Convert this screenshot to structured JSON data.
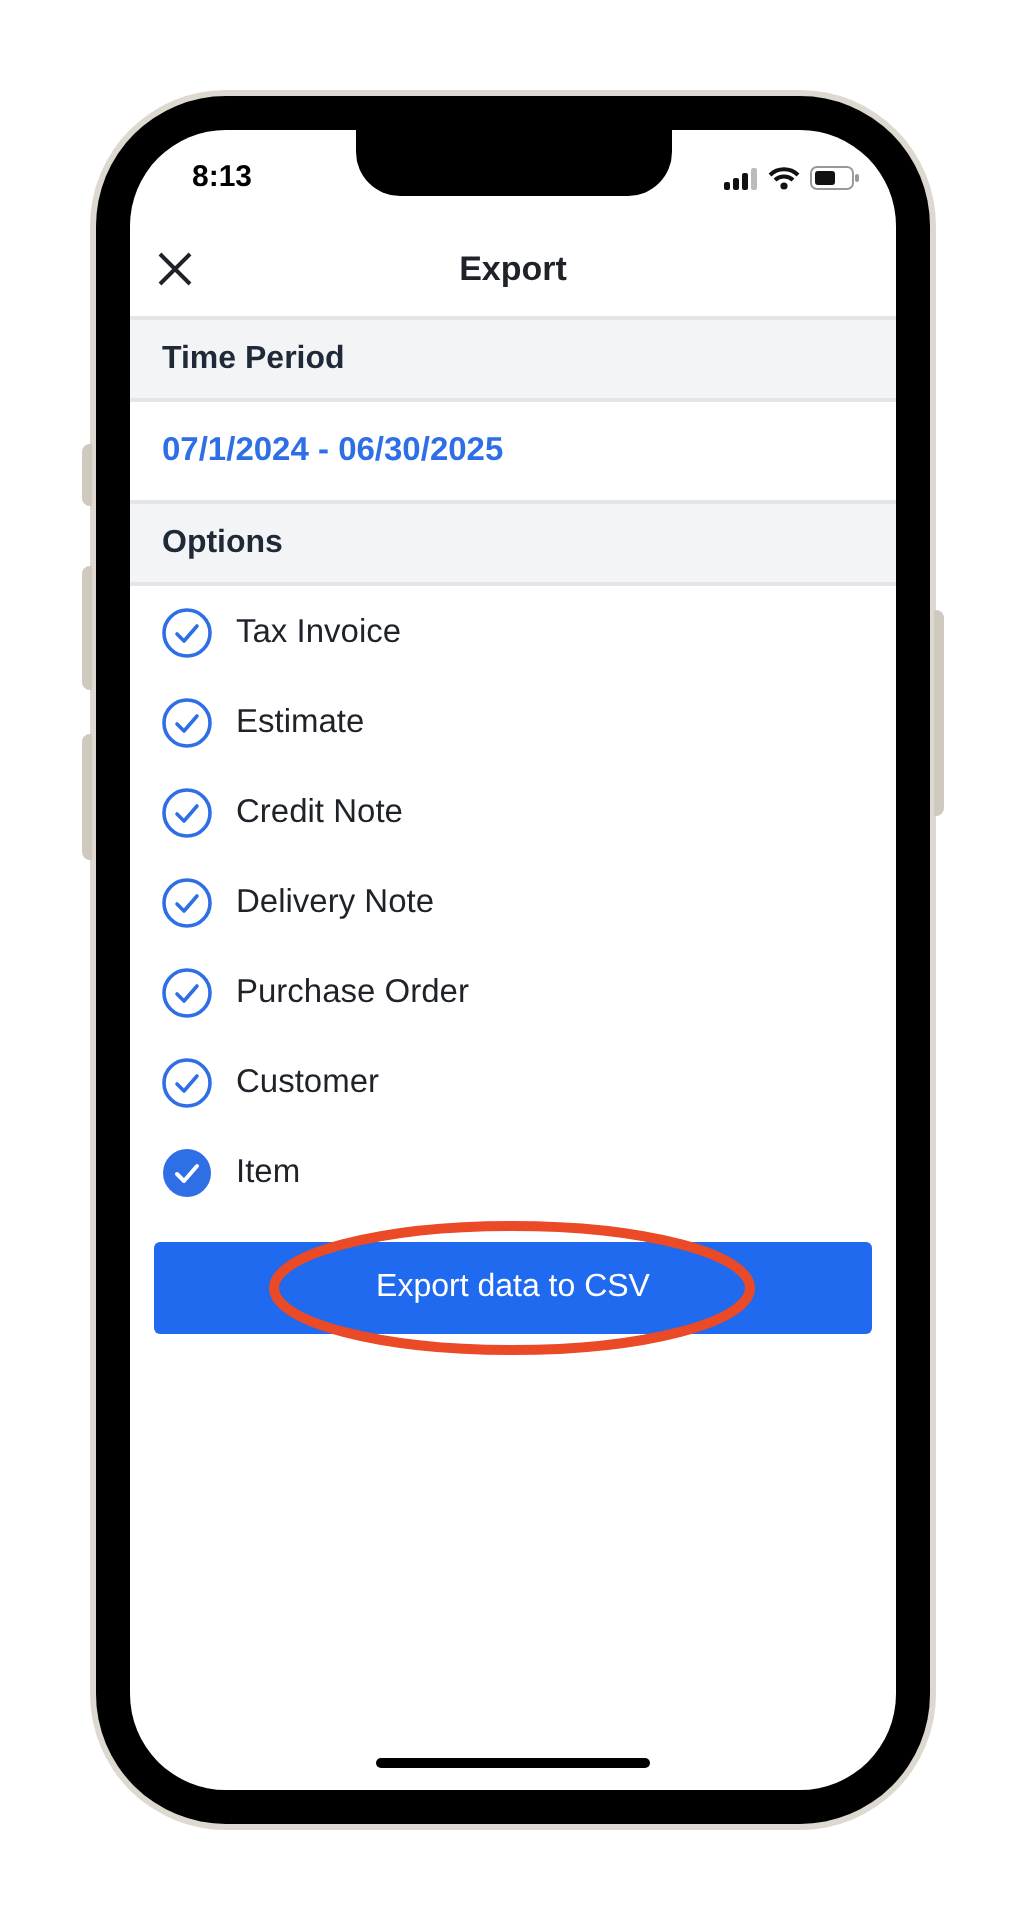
{
  "status_bar": {
    "time": "8:13"
  },
  "header": {
    "title": "Export"
  },
  "time_period": {
    "heading": "Time Period",
    "range": "07/1/2024 - 06/30/2025"
  },
  "options": {
    "heading": "Options",
    "items": [
      {
        "label": "Tax Invoice",
        "selected": false
      },
      {
        "label": "Estimate",
        "selected": false
      },
      {
        "label": "Credit Note",
        "selected": false
      },
      {
        "label": "Delivery Note",
        "selected": false
      },
      {
        "label": "Purchase Order",
        "selected": false
      },
      {
        "label": "Customer",
        "selected": false
      },
      {
        "label": "Item",
        "selected": true
      }
    ]
  },
  "export_button": {
    "label": "Export data to CSV",
    "highlighted": true
  }
}
